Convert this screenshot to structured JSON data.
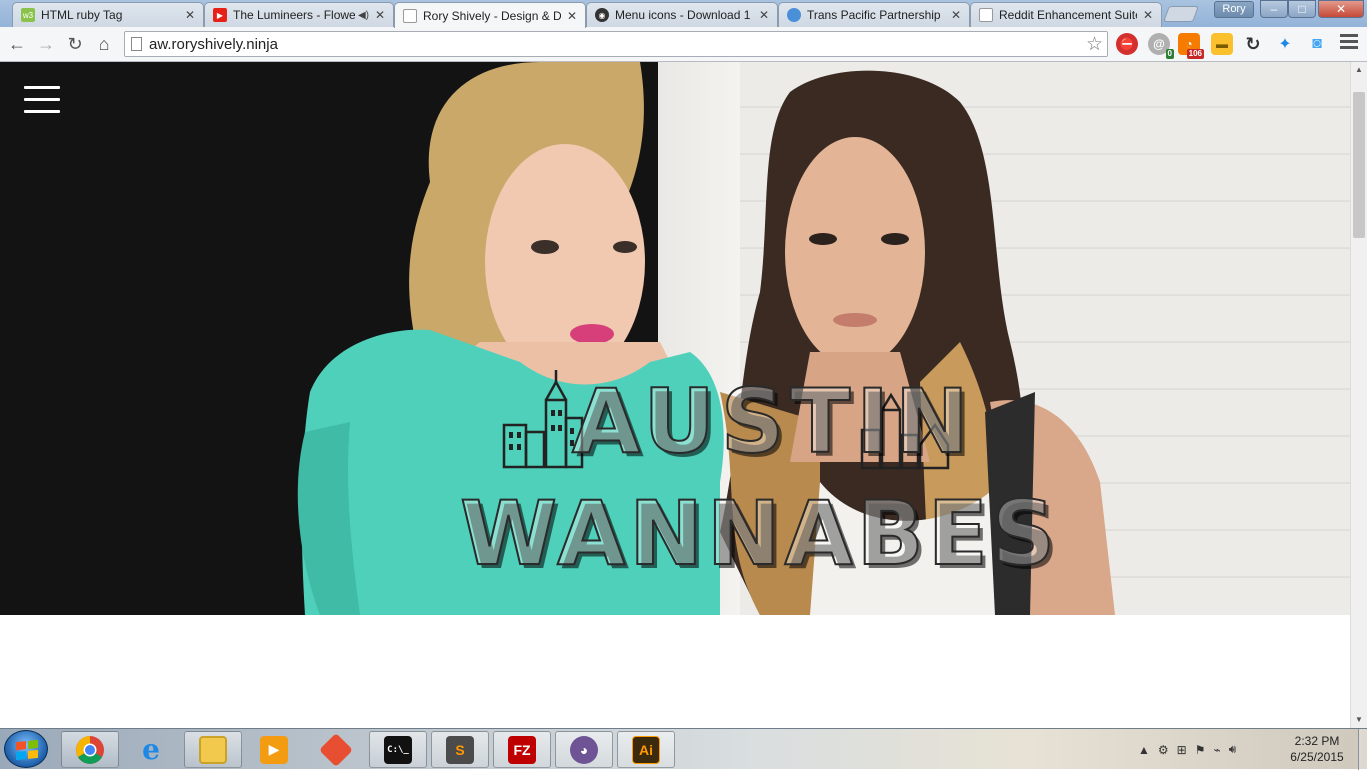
{
  "browser": {
    "tabs": [
      {
        "title": "HTML ruby Tag",
        "favicon_color": "#8bc34a",
        "favicon_text": "w3"
      },
      {
        "title": "The Lumineers - Flowe",
        "favicon_color": "#e62117",
        "favicon_text": "▶",
        "muted_icon": "speaker-icon"
      },
      {
        "title": "Rory Shively - Design & D",
        "favicon_color": "#ffffff",
        "favicon_text": "",
        "active": true
      },
      {
        "title": "Menu icons - Download 1",
        "favicon_color": "#333333",
        "favicon_text": "◉"
      },
      {
        "title": "Trans Pacific Partnership",
        "favicon_color": "#4a90d9",
        "favicon_text": "●"
      },
      {
        "title": "Reddit Enhancement Suite",
        "favicon_color": "#ffffff",
        "favicon_text": ""
      }
    ],
    "profile_name": "Rory",
    "window_buttons": {
      "minimize": "–",
      "maximize": "□",
      "close": "✕"
    },
    "url": "aw.roryshively.ninja",
    "extensions": [
      {
        "name": "adblock-icon",
        "color": "#d32f2f",
        "symbol": "⛔"
      },
      {
        "name": "email-checker-icon",
        "color": "#9e9e9e",
        "symbol": "@",
        "badge": "0",
        "badge_color": "#2e7d32"
      },
      {
        "name": "rss-feed-icon",
        "color": "#f57c00",
        "symbol": "◔",
        "badge": "106",
        "badge_color": "#c62828"
      },
      {
        "name": "folder-icon",
        "color": "#fbc02d",
        "symbol": "▬"
      },
      {
        "name": "sync-icon",
        "color": "#424242",
        "symbol": "↻"
      },
      {
        "name": "network-icon",
        "color": "#1e88e5",
        "symbol": "✦"
      },
      {
        "name": "camera-icon",
        "color": "#42a5f5",
        "symbol": "◙"
      }
    ]
  },
  "page": {
    "logo_line1": "AUSTIN",
    "logo_line2": "WANNABES",
    "menu_icon": "hamburger-menu-icon"
  },
  "taskbar": {
    "apps": [
      {
        "name": "chrome-icon",
        "color": "#ffffff",
        "active": true
      },
      {
        "name": "internet-explorer-icon",
        "color": "#1e88e5"
      },
      {
        "name": "file-explorer-icon",
        "color": "#f2c94c",
        "active": true
      },
      {
        "name": "media-player-icon",
        "color": "#f39c12"
      },
      {
        "name": "git-icon",
        "color": "#e84e31"
      },
      {
        "name": "command-prompt-icon",
        "color": "#111111",
        "active": true
      },
      {
        "name": "sublime-text-icon",
        "color": "#4b4b4b",
        "active": true
      },
      {
        "name": "filezilla-icon",
        "color": "#bf0000",
        "active": true
      },
      {
        "name": "github-icon",
        "color": "#6e5494",
        "active": true
      },
      {
        "name": "illustrator-icon",
        "color": "#3b2a0d",
        "active": true
      }
    ],
    "app_labels": {
      "cmd": "C:\\_",
      "sublime": "S",
      "filezilla": "FZ",
      "illustrator": "Ai"
    },
    "clock_time": "2:32 PM",
    "clock_date": "6/25/2015"
  }
}
